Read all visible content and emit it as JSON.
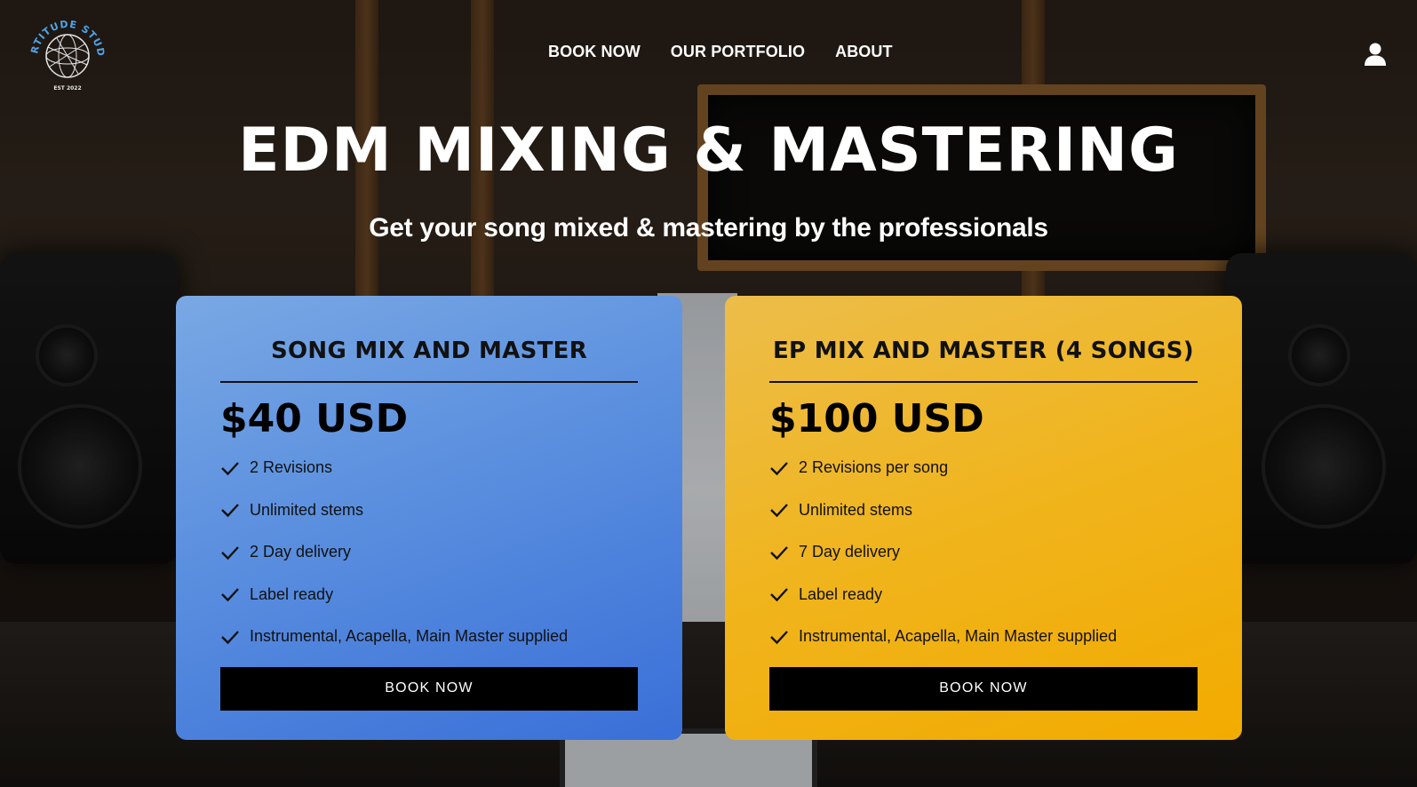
{
  "brand": {
    "logo_text": "FORTITUDE STUDIO",
    "logo_sub": "EST 2022",
    "logo_icon": "globe-icon"
  },
  "nav": {
    "items": [
      {
        "label": "BOOK NOW"
      },
      {
        "label": "OUR PORTFOLIO"
      },
      {
        "label": "ABOUT"
      }
    ],
    "user_icon": "user-icon"
  },
  "hero": {
    "title": "EDM MIXING & MASTERING",
    "subtitle": "Get your song mixed & mastering by the professionals"
  },
  "plans": [
    {
      "title": "SONG MIX AND MASTER",
      "price": "$40 USD",
      "features": [
        "2 Revisions",
        "Unlimited stems",
        "2 Day delivery",
        "Label ready",
        "Instrumental, Acapella, Main Master supplied"
      ],
      "button": "BOOK NOW",
      "color": "#4f86de"
    },
    {
      "title": "EP MIX AND MASTER (4 SONGS)",
      "price": "$100 USD",
      "features": [
        "2 Revisions per song",
        "Unlimited stems",
        "7 Day delivery",
        "Label ready",
        "Instrumental, Acapella, Main Master supplied"
      ],
      "button": "BOOK NOW",
      "color": "#f0b020"
    }
  ]
}
